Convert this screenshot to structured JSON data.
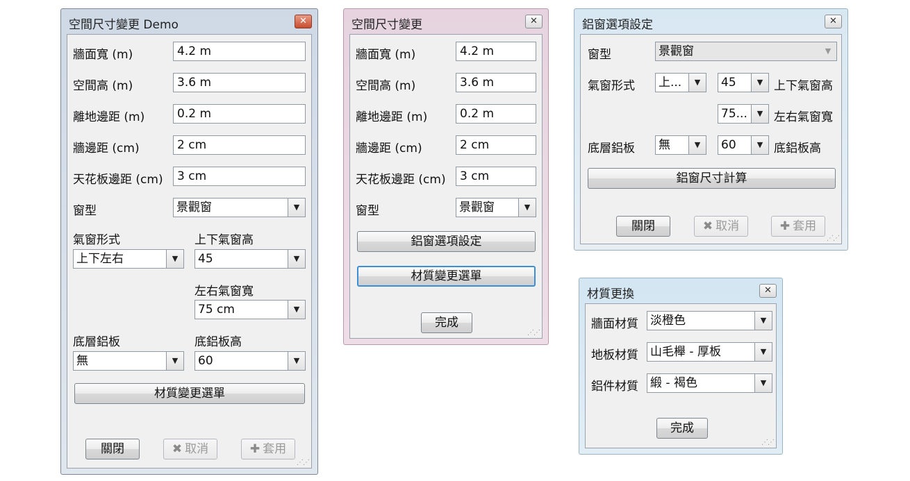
{
  "w1": {
    "title": "空間尺寸變更  Demo",
    "fields": [
      {
        "label": "牆面寬 (m)",
        "value": "4.2 m"
      },
      {
        "label": "空間高 (m)",
        "value": "3.6 m"
      },
      {
        "label": "離地邊距 (m)",
        "value": "0.2 m"
      },
      {
        "label": "牆邊距 (cm)",
        "value": "2 cm"
      },
      {
        "label": "天花板邊距 (cm)",
        "value": "3 cm"
      }
    ],
    "window_type_label": "窗型",
    "window_type_value": "景觀窗",
    "vent_style_label": "氣窗形式",
    "vent_style_value": "上下左右",
    "vent_height_label": "上下氣窗高",
    "vent_height_value": "45",
    "vent_width_label": "左右氣窗寬",
    "vent_width_value": "75 cm",
    "base_board_label": "底層鋁板",
    "base_board_value": "無",
    "base_height_label": "底鋁板高",
    "base_height_value": "60",
    "material_button": "材質變更選單",
    "close_button": "關閉",
    "cancel_button": "取消",
    "apply_button": "套用"
  },
  "w2": {
    "title": "空間尺寸變更",
    "fields": [
      {
        "label": "牆面寬 (m)",
        "value": "4.2 m"
      },
      {
        "label": "空間高 (m)",
        "value": "3.6 m"
      },
      {
        "label": "離地邊距 (m)",
        "value": "0.2 m"
      },
      {
        "label": "牆邊距 (cm)",
        "value": "2 cm"
      },
      {
        "label": "天花板邊距 (cm)",
        "value": "3 cm"
      }
    ],
    "window_type_label": "窗型",
    "window_type_value": "景觀窗",
    "aluminum_options_button": "鋁窗選項設定",
    "material_button": "材質變更選單",
    "done_button": "完成"
  },
  "w3": {
    "title": "鋁窗選項設定",
    "window_type_label": "窗型",
    "window_type_value": "景觀窗",
    "vent_style_label": "氣窗形式",
    "vent_style_value": "上...",
    "vent_height_value": "45",
    "vent_height_label": "上下氣窗高",
    "vent_width_value": "75...",
    "vent_width_label": "左右氣窗寬",
    "base_board_label": "底層鋁板",
    "base_board_value": "無",
    "base_height_value": "60",
    "base_height_label": "底鋁板高",
    "calc_button": "鋁窗尺寸計算",
    "close_button": "關閉",
    "cancel_button": "取消",
    "apply_button": "套用"
  },
  "w4": {
    "title": "材質更換",
    "wall_label": "牆面材質",
    "wall_value": "淡橙色",
    "floor_label": "地板材質",
    "floor_value": "山毛櫸 - 厚板",
    "metal_label": "鋁件材質",
    "metal_value": "緞 - 褐色",
    "done_button": "完成"
  },
  "colors": {
    "frame_active": "#d3dbe6",
    "frame_pink": "#e9d3dd",
    "frame_blue": "#d6e9f4",
    "focus_blue": "#3c8fd6"
  }
}
